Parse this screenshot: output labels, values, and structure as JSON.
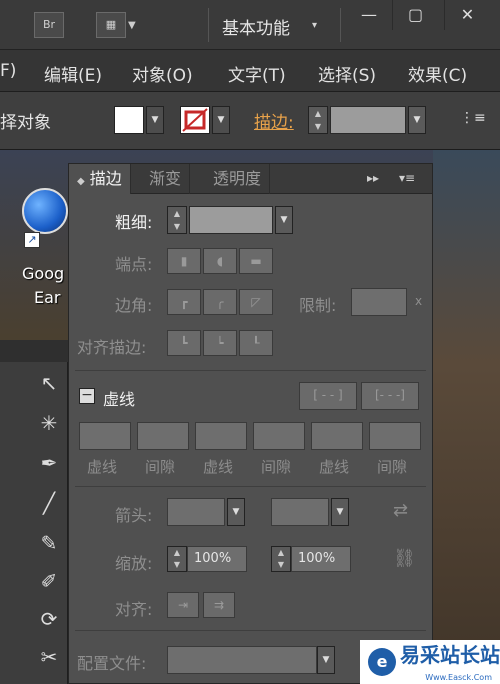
{
  "titlebar": {
    "br_label": "Br",
    "workspace": "基本功能",
    "win_min": "—",
    "win_max": "▢",
    "win_close": "✕"
  },
  "menubar": {
    "items": [
      "F)",
      "编辑(E)",
      "对象(O)",
      "文字(T)",
      "选择(S)",
      "效果(C)"
    ]
  },
  "controlbar": {
    "selection_label": "择对象",
    "stroke_label": "描边:"
  },
  "desktop": {
    "icon_label_1": "Goog",
    "icon_label_2": "Ear"
  },
  "panel": {
    "tabs": [
      "描边",
      "渐变",
      "透明度"
    ],
    "weight_label": "粗细:",
    "cap_label": "端点:",
    "corner_label": "边角:",
    "limit_label": "限制:",
    "limit_unit": "x",
    "align_label": "对齐描边:",
    "dashed_label": "虚线",
    "dash_labels": [
      "虚线",
      "间隙",
      "虚线",
      "间隙",
      "虚线",
      "间隙"
    ],
    "arrow_label": "箭头:",
    "scale_label": "缩放:",
    "scale_values": [
      "100%",
      "100%"
    ],
    "align2_label": "对齐:",
    "profile_label": "配置文件:"
  },
  "watermark": {
    "text": "易采站长站",
    "sub": "Www.Easck.Com",
    "logo": "e"
  }
}
